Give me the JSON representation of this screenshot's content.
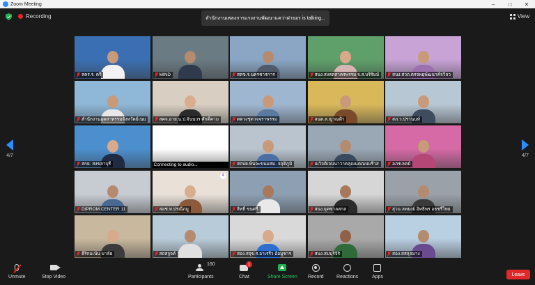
{
  "window": {
    "title": "Zoom Meeting",
    "controls": [
      "–",
      "□",
      "✕"
    ]
  },
  "infobar": {
    "recording_label": "Recording",
    "talking": "สำนักงานเพลงการแรงงานพัฒนาแคว่าฝายอร is talking...",
    "view_label": "View"
  },
  "page_nav": {
    "left": "4/7",
    "right": "4/7"
  },
  "tiles": [
    {
      "name": "สคร.ร. ตรี",
      "muted": true,
      "scene": "#3b6fb3",
      "skin": "#c99a7a",
      "shirt": "#f2f2f2",
      "speaking": false
    },
    {
      "name": "MIND",
      "muted": true,
      "scene": "#6b7b83",
      "skin": "#b58b70",
      "shirt": "#2f3a4d",
      "speaking": false
    },
    {
      "name": "สตข.ร.นครชารการ",
      "muted": true,
      "scene": "#8aa6c4",
      "skin": "#b58b70",
      "shirt": "#4f5a6a",
      "speaking": false
    },
    {
      "name": "สนง.สงสตสาครพรรม จ.ส.บริรัมม์",
      "muted": true,
      "scene": "#5fa06a",
      "skin": "#d8a98a",
      "shirt": "#d7b5b5",
      "speaking": false
    },
    {
      "name": "สนง.สวถ.ตรจพยุพัฒนาคัจวิลว",
      "muted": true,
      "scene": "#c7a3d6",
      "skin": "#c99a7a",
      "shirt": "#9b6fb0",
      "speaking": false
    },
    {
      "name": "สำนักงานอุตสาหรรมจังหวัดย์เนม",
      "muted": true,
      "scene": "#8fb7d8",
      "skin": "#c99a7a",
      "shirt": "#e8e8e8",
      "speaking": false
    },
    {
      "name": "สคจ.อาย.น.ป.จันนวร ศักดิ์คาม",
      "muted": true,
      "scene": "#d8cfc2",
      "skin": "#d9ad8e",
      "shirt": "#2b2b2b",
      "speaking": false
    },
    {
      "name": "ตตวงชุดวจจราพรรม",
      "muted": true,
      "scene": "#9fb6d0",
      "skin": "#c99a7a",
      "shirt": "#5a7aa0",
      "speaking": false
    },
    {
      "name": "ลนต.ล.ญาณฝ้า",
      "muted": true,
      "scene": "#d9b85a",
      "skin": "#c99a7a",
      "shirt": "#7a4b2a",
      "speaking": false
    },
    {
      "name": "สภ.ว.ปรานนท์",
      "muted": true,
      "scene": "#b8c7d4",
      "skin": "#c99a7a",
      "shirt": "#3e4c5e",
      "speaking": false
    },
    {
      "name": "สกย. สงขลาบุรี",
      "muted": true,
      "scene": "#4c8fcf",
      "skin": "#d8a98a",
      "shirt": "#1f2a44",
      "speaking": false
    },
    {
      "name": "Connecting to audio...",
      "muted": false,
      "connecting": true,
      "scene": "#ffffff",
      "skin": "#e7e7e7",
      "shirt": "#dcdcdc",
      "speaking": false
    },
    {
      "name": "สถปย.พ้นจะขนมสม. จฤติภูมิ",
      "muted": true,
      "scene": "#b9c4cf",
      "skin": "#c99a7a",
      "shirt": "#4a6fa5",
      "speaking": false
    },
    {
      "name": "ณวิจติเจมนาวาคลุณนคณนบรีวส",
      "muted": true,
      "scene": "#9aa7b5",
      "skin": "#b58b70",
      "shirt": "#3a4a5e",
      "speaking": false
    },
    {
      "name": "อภรเลคย์",
      "muted": true,
      "scene": "#d56aa6",
      "skin": "#c99a7a",
      "shirt": "#b54777",
      "speaking": false
    },
    {
      "name": "DIPROM CENTER 11",
      "muted": true,
      "scene": "#c7ccd3",
      "skin": "#b58b70",
      "shirt": "#486a92",
      "speaking": false
    },
    {
      "name": "สอช.ห.ปรณีภมู",
      "muted": true,
      "scene": "#e9e1d8",
      "skin": "#d9ad8e",
      "shirt": "#8a5a3a",
      "speaking": false,
      "badge": "4"
    },
    {
      "name": "สิทธิ์ ขนศรี",
      "muted": true,
      "scene": "#8da0b3",
      "skin": "#a9785c",
      "shirt": "#e9e9e9",
      "speaking": false
    },
    {
      "name": "สนง.ยุคซาลสกล",
      "muted": true,
      "scene": "#d6d6d6",
      "skin": "#a9785c",
      "shirt": "#2b2b2b",
      "speaking": false
    },
    {
      "name": "สุวน ลพยงย์ อิทธิพร อธชรีไทย",
      "muted": true,
      "scene": "#9aa1a8",
      "skin": "#b58b70",
      "shirt": "#3a3a3a",
      "speaking": false
    },
    {
      "name": "ธีริกมเน้น มาลัย",
      "muted": true,
      "scene": "#c8b89e",
      "skin": "#d8a98a",
      "shirt": "#3b3b3b",
      "speaking": false
    },
    {
      "name": "สถสจูจด์",
      "muted": true,
      "scene": "#b8cbd8",
      "skin": "#b58b70",
      "shirt": "#e0e0e0",
      "speaking": false
    },
    {
      "name": "สอง.สจุข.ร.อาเรรีว อ้อมูชาร",
      "muted": true,
      "scene": "#d9d9d9",
      "skin": "#d8a98a",
      "shirt": "#2d6fd0",
      "speaking": false
    },
    {
      "name": "สนง.สมบุริจิริ",
      "muted": true,
      "scene": "#a9a9a9",
      "skin": "#8f6248",
      "shirt": "#2f6a3a",
      "speaking": true
    },
    {
      "name": "สอง.สสลุจมาง",
      "muted": true,
      "scene": "#b9cfe2",
      "skin": "#b58b70",
      "shirt": "#6a4b8f",
      "speaking": false
    }
  ],
  "toolbar": {
    "unmute": "Unmute",
    "stop_video": "Stop Video",
    "participants": "Participants",
    "participant_count": "160",
    "chat": "Chat",
    "chat_badge": "1",
    "share_screen": "Share Screen",
    "record": "Record",
    "reactions": "Reactions",
    "apps": "Apps",
    "leave": "Leave",
    "caret": "^"
  },
  "colors": {
    "accent": "#2d8cff",
    "muted": "#e02828",
    "share": "#22b14c",
    "speaking": "#8fd14f",
    "leave": "#e02828"
  }
}
